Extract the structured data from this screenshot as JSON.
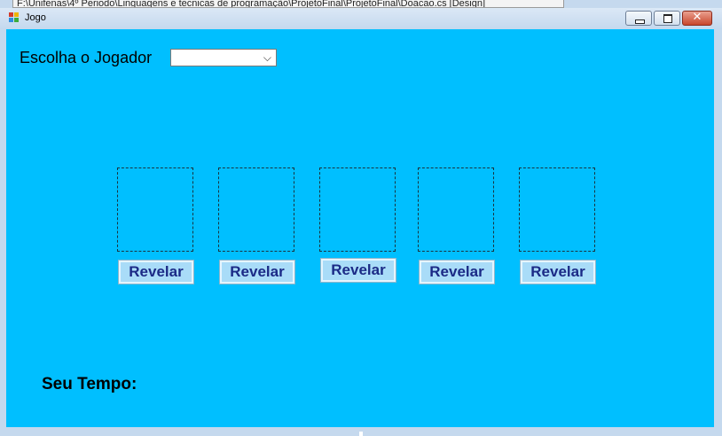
{
  "tooltip": {
    "text": "F:\\Unifenas\\4º Periodo\\Linguagens e tecnicas de programação\\ProjetoFinal\\ProjetoFinal\\Doacao.cs [Design]"
  },
  "window": {
    "title": "Jogo",
    "colors": {
      "client_bg": "#00bfff",
      "button_text": "#1b2a86",
      "button_bg": "#a9dcf8"
    }
  },
  "form": {
    "jogador_label": "Escolha o Jogador",
    "jogador_select": {
      "selected": "",
      "options": []
    },
    "cards": [
      {
        "button_label": "Revelar"
      },
      {
        "button_label": "Revelar"
      },
      {
        "button_label": "Revelar"
      },
      {
        "button_label": "Revelar"
      },
      {
        "button_label": "Revelar"
      }
    ],
    "tempo_label": "Seu Tempo:"
  },
  "icons": [
    "app-icon",
    "minimize-icon",
    "maximize-icon",
    "close-icon",
    "chevron-down-icon"
  ]
}
